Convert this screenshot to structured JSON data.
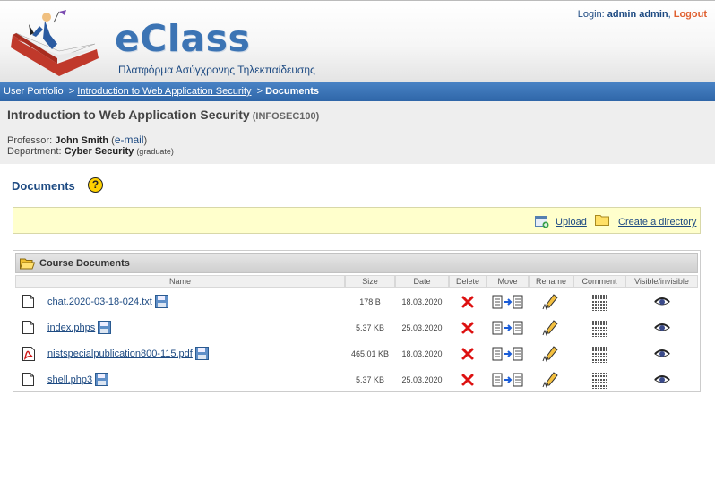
{
  "header": {
    "logo_title": "eClass",
    "logo_subtitle": "Πλατφόρμα Ασύγχρονης Τηλεκπαίδευσης",
    "login_label": "Login:",
    "username": "admin admin",
    "separator": ",",
    "logout": "Logout"
  },
  "breadcrumb": {
    "portfolio": "User Portfolio",
    "sep1": ">",
    "course": "Introduction to Web Application Security",
    "sep2": ">",
    "current": "Documents"
  },
  "course": {
    "title": "Introduction to Web Application Security",
    "code": "(INFOSEC100)",
    "professor_label": "Professor:",
    "professor_name": "John Smith",
    "email_link": "e-mail",
    "department_label": "Department:",
    "department_name": "Cyber Security",
    "department_level": "(graduate)"
  },
  "section": {
    "title": "Documents",
    "help_symbol": "?"
  },
  "toolbar": {
    "upload": "Upload",
    "create_directory": "Create a directory"
  },
  "documents": {
    "folder_title": "Course Documents",
    "columns": [
      "Name",
      "Size",
      "Date",
      "Delete",
      "Move",
      "Rename",
      "Comment",
      "Visible/invisible"
    ],
    "rows": [
      {
        "name": "chat.2020-03-18-024.txt",
        "size": "178 B",
        "date": "18.03.2020",
        "file_icon": "file-icon"
      },
      {
        "name": "index.phps",
        "size": "5.37 KB",
        "date": "25.03.2020",
        "file_icon": "file-icon"
      },
      {
        "name": "nistspecialpublication800-115.pdf",
        "size": "465.01 KB",
        "date": "18.03.2020",
        "file_icon": "pdf-icon"
      },
      {
        "name": "shell.php3",
        "size": "5.37 KB",
        "date": "25.03.2020",
        "file_icon": "file-icon"
      }
    ]
  },
  "colors": {
    "brand_blue": "#3c74b4",
    "bar_blue": "#2f66a8",
    "logout_orange": "#e06030",
    "toolbar_yellow": "#ffffcc",
    "delete_red": "#dd1111"
  }
}
